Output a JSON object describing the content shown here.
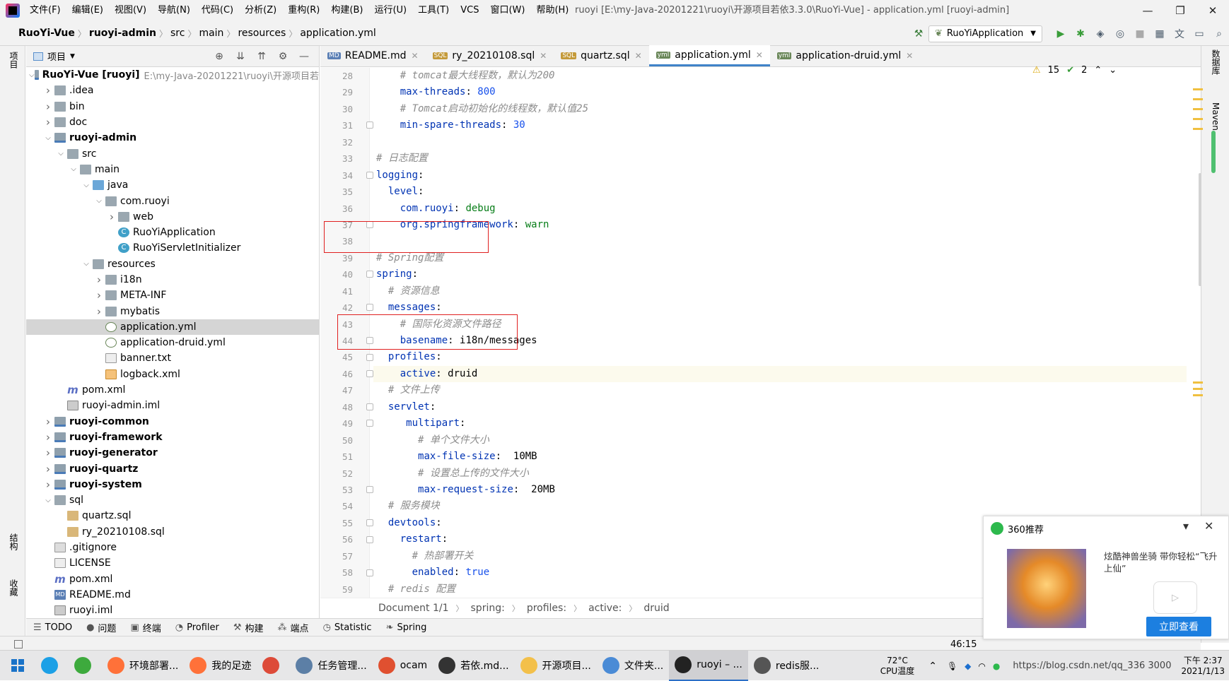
{
  "menubar": {
    "items": [
      "文件(F)",
      "编辑(E)",
      "视图(V)",
      "导航(N)",
      "代码(C)",
      "分析(Z)",
      "重构(R)",
      "构建(B)",
      "运行(U)",
      "工具(T)",
      "VCS",
      "窗口(W)",
      "帮助(H)"
    ],
    "window_title": "ruoyi [E:\\my-Java-20201221\\ruoyi\\开源项目若依3.3.0\\RuoYi-Vue] - application.yml [ruoyi-admin]",
    "minimize": "—",
    "restore": "❐",
    "close": "✕"
  },
  "navbar": {
    "crumbs": [
      "RuoYi-Vue",
      "ruoyi-admin",
      "src",
      "main",
      "resources",
      "application.yml"
    ],
    "run_config": "RuoYiApplication"
  },
  "left_strip": {
    "project_label": "项目",
    "structure_label": "结构",
    "favorites_label": "收藏"
  },
  "right_strip": {
    "database_label": "数据库",
    "maven_label": "Maven"
  },
  "project": {
    "title": "项目",
    "tree": [
      {
        "name": "RuoYi-Vue [ruoyi]",
        "extra": "E:\\my-Java-20201221\\ruoyi\\开源项目若",
        "depth": 0,
        "arrow": "open",
        "icon": "module",
        "bold": true
      },
      {
        "name": ".idea",
        "depth": 1,
        "arrow": "closed",
        "icon": "folder"
      },
      {
        "name": "bin",
        "depth": 1,
        "arrow": "closed",
        "icon": "folder"
      },
      {
        "name": "doc",
        "depth": 1,
        "arrow": "closed",
        "icon": "folder"
      },
      {
        "name": "ruoyi-admin",
        "depth": 1,
        "arrow": "open",
        "icon": "module",
        "bold": true
      },
      {
        "name": "src",
        "depth": 2,
        "arrow": "open",
        "icon": "folder"
      },
      {
        "name": "main",
        "depth": 3,
        "arrow": "open",
        "icon": "folder"
      },
      {
        "name": "java",
        "depth": 4,
        "arrow": "open",
        "icon": "folder-blue"
      },
      {
        "name": "com.ruoyi",
        "depth": 5,
        "arrow": "open",
        "icon": "folder"
      },
      {
        "name": "web",
        "depth": 6,
        "arrow": "closed",
        "icon": "folder"
      },
      {
        "name": "RuoYiApplication",
        "depth": 6,
        "arrow": "none",
        "icon": "cls"
      },
      {
        "name": "RuoYiServletInitializer",
        "depth": 6,
        "arrow": "none",
        "icon": "cls"
      },
      {
        "name": "resources",
        "depth": 4,
        "arrow": "open",
        "icon": "folder"
      },
      {
        "name": "i18n",
        "depth": 5,
        "arrow": "closed",
        "icon": "folder"
      },
      {
        "name": "META-INF",
        "depth": 5,
        "arrow": "closed",
        "icon": "folder"
      },
      {
        "name": "mybatis",
        "depth": 5,
        "arrow": "closed",
        "icon": "folder"
      },
      {
        "name": "application.yml",
        "depth": 5,
        "arrow": "none",
        "icon": "yml",
        "selected": true
      },
      {
        "name": "application-druid.yml",
        "depth": 5,
        "arrow": "none",
        "icon": "yml"
      },
      {
        "name": "banner.txt",
        "depth": 5,
        "arrow": "none",
        "icon": "txtf"
      },
      {
        "name": "logback.xml",
        "depth": 5,
        "arrow": "none",
        "icon": "xmlf"
      },
      {
        "name": "pom.xml",
        "depth": 2,
        "arrow": "none",
        "icon": "mvn"
      },
      {
        "name": "ruoyi-admin.iml",
        "depth": 2,
        "arrow": "none",
        "icon": "iml"
      },
      {
        "name": "ruoyi-common",
        "depth": 1,
        "arrow": "closed",
        "icon": "module",
        "bold": true
      },
      {
        "name": "ruoyi-framework",
        "depth": 1,
        "arrow": "closed",
        "icon": "module",
        "bold": true
      },
      {
        "name": "ruoyi-generator",
        "depth": 1,
        "arrow": "closed",
        "icon": "module",
        "bold": true
      },
      {
        "name": "ruoyi-quartz",
        "depth": 1,
        "arrow": "closed",
        "icon": "module",
        "bold": true
      },
      {
        "name": "ruoyi-system",
        "depth": 1,
        "arrow": "closed",
        "icon": "module",
        "bold": true
      },
      {
        "name": "sql",
        "depth": 1,
        "arrow": "open",
        "icon": "folder"
      },
      {
        "name": "quartz.sql",
        "depth": 2,
        "arrow": "none",
        "icon": "sqlf"
      },
      {
        "name": "ry_20210108.sql",
        "depth": 2,
        "arrow": "none",
        "icon": "sqlf"
      },
      {
        "name": ".gitignore",
        "depth": 1,
        "arrow": "none",
        "icon": "git"
      },
      {
        "name": "LICENSE",
        "depth": 1,
        "arrow": "none",
        "icon": "txtf"
      },
      {
        "name": "pom.xml",
        "depth": 1,
        "arrow": "none",
        "icon": "mvn"
      },
      {
        "name": "README.md",
        "depth": 1,
        "arrow": "none",
        "icon": "mdf"
      },
      {
        "name": "ruoyi.iml",
        "depth": 1,
        "arrow": "none",
        "icon": "iml"
      }
    ]
  },
  "editor": {
    "tabs": [
      {
        "label": "README.md",
        "badge": "MD",
        "active": false
      },
      {
        "label": "ry_20210108.sql",
        "badge": "SQL",
        "active": false
      },
      {
        "label": "quartz.sql",
        "badge": "SQL",
        "active": false
      },
      {
        "label": "application.yml",
        "badge": "yml",
        "active": true
      },
      {
        "label": "application-druid.yml",
        "badge": "yml",
        "active": false
      }
    ],
    "warnings": "15",
    "checks": "2",
    "lines": [
      {
        "n": "28",
        "ind": 4,
        "parts": [
          [
            "c",
            "# tomcat最大线程数，默认为200"
          ]
        ]
      },
      {
        "n": "29",
        "ind": 4,
        "parts": [
          [
            "k",
            "max-threads"
          ],
          [
            "p",
            ": "
          ],
          [
            "n",
            "800"
          ]
        ]
      },
      {
        "n": "30",
        "ind": 4,
        "parts": [
          [
            "c",
            "# Tomcat启动初始化的线程数，默认值25"
          ]
        ]
      },
      {
        "n": "31",
        "ind": 4,
        "parts": [
          [
            "k",
            "min-spare-threads"
          ],
          [
            "p",
            ": "
          ],
          [
            "n",
            "30"
          ]
        ]
      },
      {
        "n": "32",
        "ind": 0,
        "parts": []
      },
      {
        "n": "33",
        "ind": 0,
        "parts": [
          [
            "c",
            "# 日志配置"
          ]
        ]
      },
      {
        "n": "34",
        "ind": 0,
        "parts": [
          [
            "k",
            "logging"
          ],
          [
            "p",
            ":"
          ]
        ]
      },
      {
        "n": "35",
        "ind": 2,
        "parts": [
          [
            "k",
            "level"
          ],
          [
            "p",
            ":"
          ]
        ]
      },
      {
        "n": "36",
        "ind": 4,
        "parts": [
          [
            "k",
            "com.ruoyi"
          ],
          [
            "p",
            ": "
          ],
          [
            "v",
            "debug"
          ]
        ]
      },
      {
        "n": "37",
        "ind": 4,
        "parts": [
          [
            "k",
            "org.springframework"
          ],
          [
            "p",
            ": "
          ],
          [
            "v",
            "warn"
          ]
        ]
      },
      {
        "n": "38",
        "ind": 0,
        "parts": []
      },
      {
        "n": "39",
        "ind": 0,
        "parts": [
          [
            "c",
            "# Spring配置"
          ]
        ]
      },
      {
        "n": "40",
        "ind": 0,
        "parts": [
          [
            "k",
            "spring"
          ],
          [
            "p",
            ":"
          ]
        ]
      },
      {
        "n": "41",
        "ind": 2,
        "parts": [
          [
            "c",
            "# 资源信息"
          ]
        ]
      },
      {
        "n": "42",
        "ind": 2,
        "parts": [
          [
            "k",
            "messages"
          ],
          [
            "p",
            ":"
          ]
        ]
      },
      {
        "n": "43",
        "ind": 4,
        "parts": [
          [
            "c",
            "# 国际化资源文件路径"
          ]
        ]
      },
      {
        "n": "44",
        "ind": 4,
        "parts": [
          [
            "k",
            "basename"
          ],
          [
            "p",
            ": "
          ],
          [
            "p",
            "i18n/messages"
          ]
        ]
      },
      {
        "n": "45",
        "ind": 2,
        "parts": [
          [
            "k",
            "profiles"
          ],
          [
            "p",
            ":"
          ]
        ]
      },
      {
        "n": "46",
        "ind": 4,
        "parts": [
          [
            "k",
            "active"
          ],
          [
            "p",
            ": "
          ],
          [
            "p",
            "druid"
          ]
        ],
        "current": true
      },
      {
        "n": "47",
        "ind": 2,
        "parts": [
          [
            "c",
            "# 文件上传"
          ]
        ]
      },
      {
        "n": "48",
        "ind": 2,
        "parts": [
          [
            "k",
            "servlet"
          ],
          [
            "p",
            ":"
          ]
        ]
      },
      {
        "n": "49",
        "ind": 5,
        "parts": [
          [
            "k",
            "multipart"
          ],
          [
            "p",
            ":"
          ]
        ]
      },
      {
        "n": "50",
        "ind": 7,
        "parts": [
          [
            "c",
            "# 单个文件大小"
          ]
        ]
      },
      {
        "n": "51",
        "ind": 7,
        "parts": [
          [
            "k",
            "max-file-size"
          ],
          [
            "p",
            ":  "
          ],
          [
            "p",
            "10MB"
          ]
        ]
      },
      {
        "n": "52",
        "ind": 7,
        "parts": [
          [
            "c",
            "# 设置总上传的文件大小"
          ]
        ]
      },
      {
        "n": "53",
        "ind": 7,
        "parts": [
          [
            "k",
            "max-request-size"
          ],
          [
            "p",
            ":  "
          ],
          [
            "p",
            "20MB"
          ]
        ]
      },
      {
        "n": "54",
        "ind": 2,
        "parts": [
          [
            "c",
            "# 服务模块"
          ]
        ]
      },
      {
        "n": "55",
        "ind": 2,
        "parts": [
          [
            "k",
            "devtools"
          ],
          [
            "p",
            ":"
          ]
        ]
      },
      {
        "n": "56",
        "ind": 4,
        "parts": [
          [
            "k",
            "restart"
          ],
          [
            "p",
            ":"
          ]
        ]
      },
      {
        "n": "57",
        "ind": 6,
        "parts": [
          [
            "c",
            "# 热部署开关"
          ]
        ]
      },
      {
        "n": "58",
        "ind": 6,
        "parts": [
          [
            "k",
            "enabled"
          ],
          [
            "p",
            ": "
          ],
          [
            "n",
            "true"
          ]
        ]
      },
      {
        "n": "59",
        "ind": 2,
        "parts": [
          [
            "c",
            "# redis 配置"
          ]
        ]
      }
    ],
    "breadcrumb": [
      "Document 1/1",
      "spring:",
      "profiles:",
      "active:",
      "druid"
    ]
  },
  "tool_windows": [
    {
      "glyph": "☰",
      "label": "TODO"
    },
    {
      "glyph": "●",
      "label": "问题"
    },
    {
      "glyph": "▣",
      "label": "终端"
    },
    {
      "glyph": "◔",
      "label": "Profiler"
    },
    {
      "glyph": "⚒",
      "label": "构建"
    },
    {
      "glyph": "⁂",
      "label": "端点"
    },
    {
      "glyph": "◷",
      "label": "Statistic"
    },
    {
      "glyph": "❧",
      "label": "Spring"
    }
  ],
  "status": {
    "caret": "46:15"
  },
  "popup": {
    "title": "360推荐",
    "text": "炫酷神兽坐骑 带你轻松“飞升上仙”",
    "cta": "立即查看"
  },
  "taskbar": {
    "apps": [
      {
        "label": "",
        "color": "#1ca0e6",
        "active": false
      },
      {
        "label": "",
        "color": "#3daa3d",
        "active": false
      },
      {
        "label": "环境部署...",
        "color": "#ff7139",
        "active": false
      },
      {
        "label": "我的足迹",
        "color": "#ff7139",
        "active": false
      },
      {
        "label": "",
        "color": "#dd4b39",
        "active": false
      },
      {
        "label": "任务管理...",
        "color": "#5c7fa6",
        "active": false
      },
      {
        "label": "ocam",
        "color": "#e05030",
        "active": false
      },
      {
        "label": "若依.md...",
        "color": "#333333",
        "active": false
      },
      {
        "label": "开源项目...",
        "color": "#f3c04a",
        "active": false
      },
      {
        "label": "文件夹...",
        "color": "#4a8bd6",
        "active": false
      },
      {
        "label": "ruoyi – ...",
        "color": "#222222",
        "active": true
      },
      {
        "label": "redis服...",
        "color": "#555555",
        "active": false
      }
    ],
    "temp": "72°C",
    "temp_label": "CPU温度",
    "url_hint": "https://blog.csdn.net/qq_336 3000",
    "time": "下午 2:37",
    "date": "2021/1/13"
  }
}
